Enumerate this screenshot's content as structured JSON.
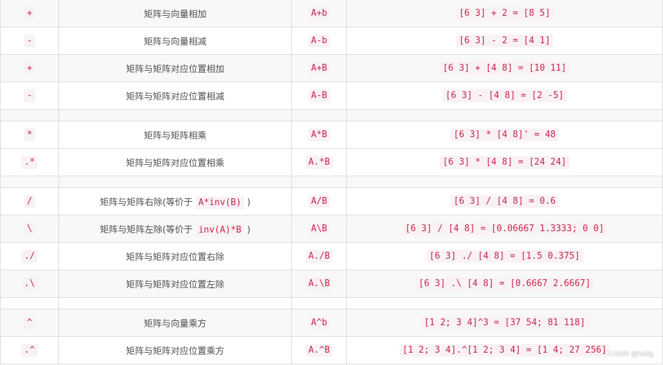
{
  "rows": [
    {
      "op": "+",
      "desc": "矩阵与向量相加",
      "expr": "A+b",
      "example": "[6 3] + 2 = [8 5]"
    },
    {
      "op": "-",
      "desc": "矩阵与向量相减",
      "expr": "A-b",
      "example": "[6 3] - 2 = [4 1]"
    },
    {
      "op": "+",
      "desc": "矩阵与矩阵对应位置相加",
      "expr": "A+B",
      "example": "[6 3] + [4 8] = [10 11]"
    },
    {
      "op": "-",
      "desc": "矩阵与矩阵对应位置相减",
      "expr": "A-B",
      "example": "[6 3] - [4 8] = [2 -5]"
    },
    {
      "op": "*",
      "desc": "矩阵与矩阵相乘",
      "expr": "A*B",
      "example": "[6 3] * [4 8]' = 48"
    },
    {
      "op": ".*",
      "desc": "矩阵与矩阵对应位置相乘",
      "expr": "A.*B",
      "example": "[6 3] * [4 8] = [24 24]"
    },
    {
      "op": "/",
      "desc_pre": "矩阵与矩阵右除(等价于 ",
      "desc_code": "A*inv(B)",
      "desc_post": " )",
      "expr": "A/B",
      "example": "[6 3] / [4 8] = 0.6"
    },
    {
      "op": "\\",
      "desc_pre": "矩阵与矩阵左除(等价于 ",
      "desc_code": "inv(A)*B",
      "desc_post": " )",
      "expr": "A\\B",
      "example": "[6 3] / [4 8] = [0.06667 1.3333; 0 0]"
    },
    {
      "op": "./",
      "desc": "矩阵与矩阵对应位置右除",
      "expr": "A./B",
      "example": "[6 3] ./ [4 8] = [1.5 0.375]"
    },
    {
      "op": ".\\",
      "desc": "矩阵与矩阵对应位置左除",
      "expr": "A.\\B",
      "example": "[6 3] .\\ [4 8] = [0.6667 2.6667]"
    },
    {
      "op": "^",
      "desc": "矩阵与向量乘方",
      "expr": "A^b",
      "example": "[1 2; 3 4]^3 = [37 54; 81 118]"
    },
    {
      "op": ".^",
      "desc": "矩阵与矩阵对应位置乘方",
      "expr": "A.^B",
      "example": "[1 2; 3 4].^[1 2; 3 4] = [1 4; 27 256]"
    }
  ],
  "watermark": "CSDN @hellg"
}
